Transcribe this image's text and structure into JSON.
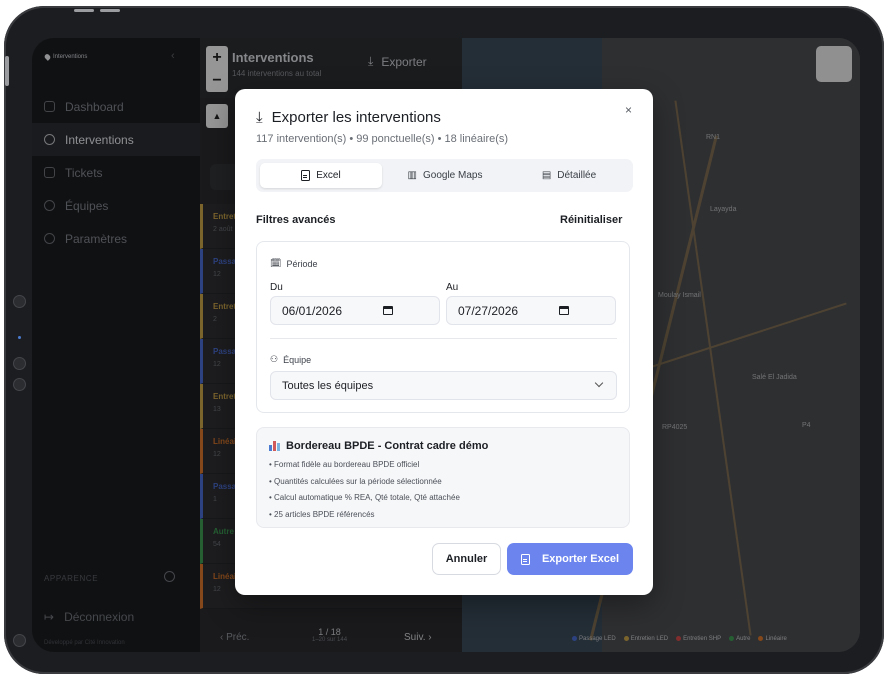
{
  "sidebar": {
    "logo_text": "Interventions",
    "items": [
      {
        "label": "Dashboard"
      },
      {
        "label": "Interventions"
      },
      {
        "label": "Tickets"
      },
      {
        "label": "Équipes"
      },
      {
        "label": "Paramètres"
      }
    ],
    "appearance_label": "APPARENCE",
    "logout_label": "Déconnexion",
    "footer_text": "Développé par Cité Innovation"
  },
  "panel": {
    "title": "Interventions",
    "subtitle": "144 interventions au total",
    "export_label": "Exporter",
    "rows": [
      {
        "type": "Entretien",
        "meta": "2 août",
        "color": "#c9a34a"
      },
      {
        "type": "Passage",
        "meta": "12",
        "color": "#4a6bd0"
      },
      {
        "type": "Entretien",
        "meta": "2",
        "color": "#c9a34a"
      },
      {
        "type": "Passage",
        "meta": "12",
        "color": "#4a6bd0"
      },
      {
        "type": "Entretien",
        "meta": "13",
        "color": "#c9a34a"
      },
      {
        "type": "Linéaire",
        "meta": "12",
        "color": "#d7752a"
      },
      {
        "type": "Passage",
        "meta": "1",
        "color": "#4a6bd0"
      },
      {
        "type": "Autre",
        "meta": "54",
        "color": "#3d9a52"
      },
      {
        "type": "Linéaire",
        "meta": "12",
        "color": "#d7752a"
      }
    ],
    "pager": {
      "prev": "‹ Préc.",
      "page": "1 / 18",
      "range": "1–20 sur 144",
      "next": "Suiv. ›"
    }
  },
  "map": {
    "labels": [
      "RN1",
      "Layayda",
      "Moulay Ismail",
      "Salé El Jadida",
      "RP4025",
      "P4"
    ],
    "legend": [
      {
        "label": "Passage LED",
        "color": "#4a6bd0"
      },
      {
        "label": "Entretien LED",
        "color": "#c9a34a"
      },
      {
        "label": "Entretien SHP",
        "color": "#d04a4a"
      },
      {
        "label": "Autre",
        "color": "#3d9a52"
      },
      {
        "label": "Linéaire",
        "color": "#d7752a"
      }
    ]
  },
  "modal": {
    "title": "Exporter les interventions",
    "subtitle": "117 intervention(s) • 99 ponctuelle(s) • 18 linéaire(s)",
    "close_label": "×",
    "tabs": [
      {
        "label": "Excel",
        "active": true
      },
      {
        "label": "Google Maps",
        "active": false
      },
      {
        "label": "Détaillée",
        "active": false
      }
    ],
    "filters_label": "Filtres avancés",
    "reset_label": "Réinitialiser",
    "period_label": "Période",
    "from_label": "Du",
    "from_value": "06/01/2026",
    "to_label": "Au",
    "to_value": "07/27/2026",
    "team_label": "Équipe",
    "team_value": "Toutes les équipes",
    "info": {
      "title": "Bordereau BPDE - Contrat cadre démo",
      "bullets": [
        "• Format fidèle au bordereau BPDE officiel",
        "• Quantités calculées sur la période sélectionnée",
        "• Calcul automatique % REA, Qté totale, Qté attachée",
        "• 25 articles BPDE référencés"
      ]
    },
    "cancel_label": "Annuler",
    "export_label": "Exporter Excel",
    "accent": "#6b84ee"
  }
}
